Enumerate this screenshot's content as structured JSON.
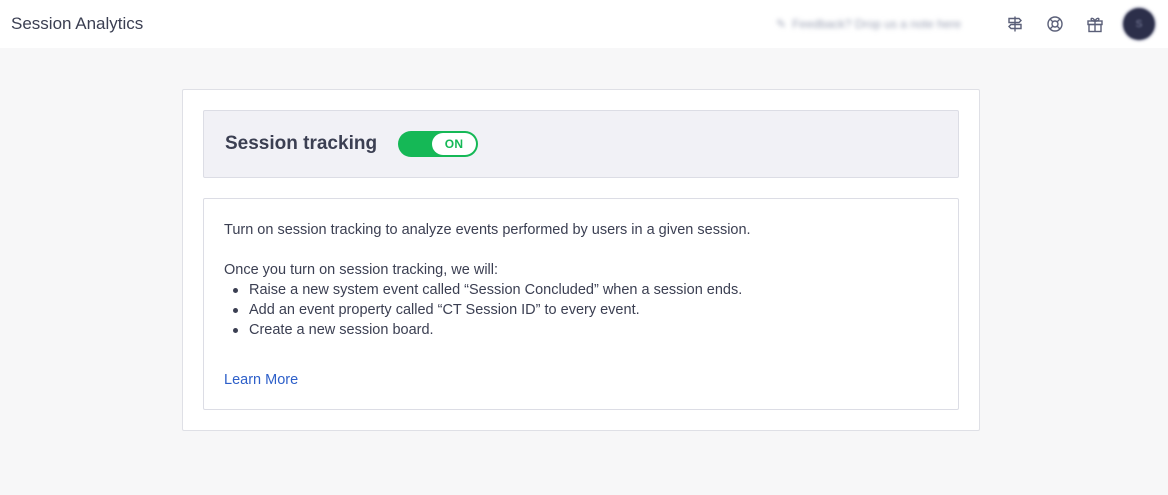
{
  "header": {
    "app_title": "Session Analytics",
    "feedback_text": "Feedback? Drop us a note here",
    "icons": [
      "signpost-icon",
      "lifebuoy-icon",
      "gift-icon"
    ],
    "avatar_initial": "S"
  },
  "section": {
    "title": "Session tracking",
    "toggle_label": "ON",
    "toggle_on": true,
    "accent_color": "#15b856"
  },
  "body": {
    "intro": "Turn on session tracking to analyze events performed by users in a given session.",
    "list_heading": "Once you turn on session tracking, we will:",
    "items": [
      "Raise a new system event called “Session Concluded” when a session ends.",
      "Add an event property called “CT Session ID” to every event.",
      "Create a new session board."
    ],
    "learn_more": "Learn More",
    "link_color": "#2d5fc9"
  }
}
